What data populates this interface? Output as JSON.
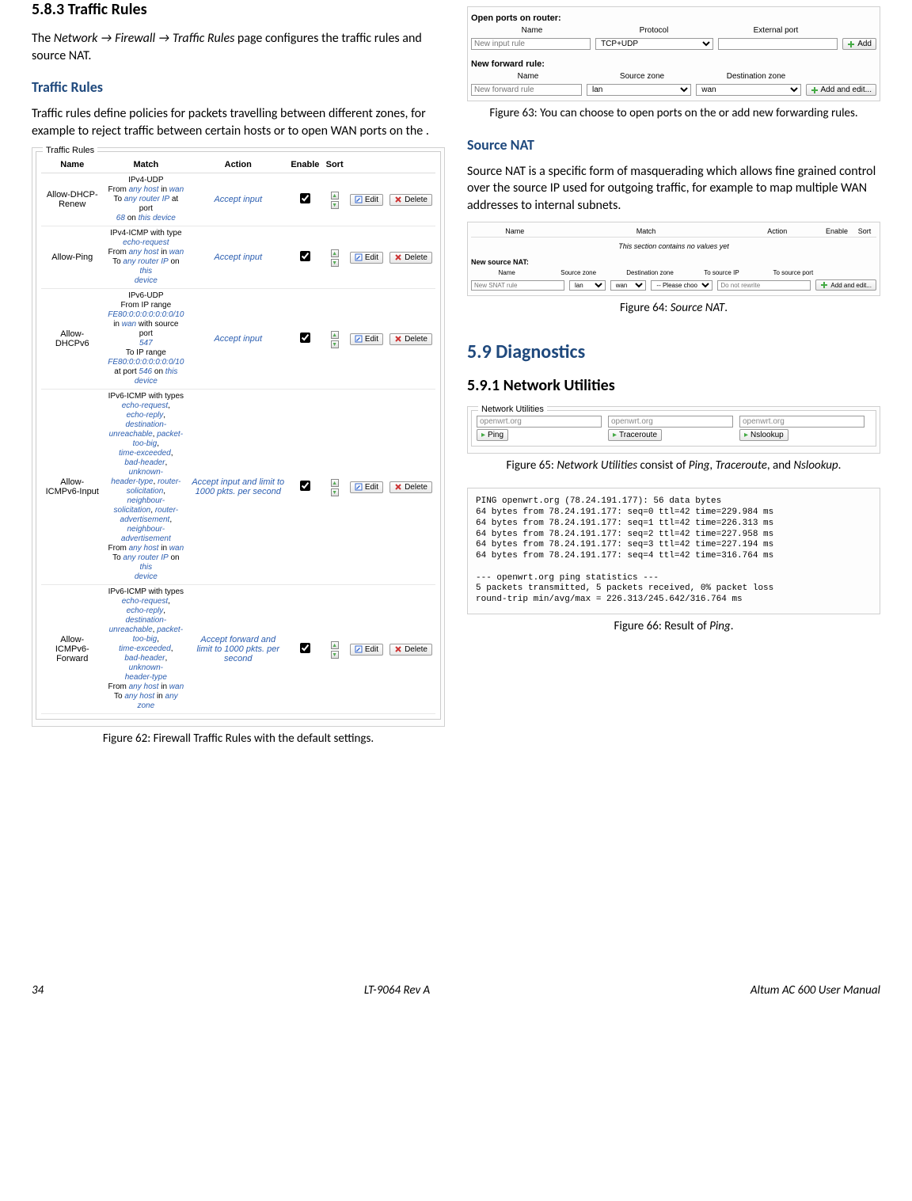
{
  "left": {
    "section_num": "5.8.3",
    "section_title": "Traffic Rules",
    "intro_pre": "The ",
    "intro_path": "Network → Firewall → Traffic Rules",
    "intro_post": " page configures the traffic rules and source NAT.",
    "h_traffic": "Traffic Rules",
    "traffic_para": "Traffic rules define policies for packets travelling between different zones, for example to reject traffic between certain hosts or to open WAN ports on the .",
    "fig62_caption": "Figure 62: Firewall Traffic Rules with the default settings.",
    "fig62": {
      "legend": "Traffic Rules",
      "headers": [
        "Name",
        "Match",
        "Action",
        "Enable",
        "Sort",
        "",
        ""
      ],
      "edit": "Edit",
      "delete": "Delete",
      "rows": [
        {
          "name": "Allow-DHCP-Renew",
          "match_lines": [
            "IPv4-UDP",
            "From <b>any host</b> in <b>wan</b>",
            "To <b>any router IP</b> at port",
            "<b>68</b> on <b>this device</b>"
          ],
          "action": "Accept input"
        },
        {
          "name": "Allow-Ping",
          "match_lines": [
            "IPv4-ICMP with type",
            "<b>echo-request</b>",
            "From <b>any host</b> in <b>wan</b>",
            "To <b>any router IP</b> on <b>this</b>",
            "<b>device</b>"
          ],
          "action": "Accept input"
        },
        {
          "name": "Allow-DHCPv6",
          "match_lines": [
            "IPv6-UDP",
            "From IP range",
            "<b>FE80:0:0:0:0:0:0:0/10</b>",
            "in <b>wan</b> with source port",
            "<b>547</b>",
            "To IP range",
            "<b>FE80:0:0:0:0:0:0:0/10</b>",
            "at port <b>546</b> on <b>this</b>",
            "<b>device</b>"
          ],
          "action": "Accept input"
        },
        {
          "name": "Allow-ICMPv6-Input",
          "match_lines": [
            "IPv6-ICMP with types",
            "<b>echo-request</b>,",
            "<b>echo-reply</b>, <b>destination-</b>",
            "<b>unreachable</b>, <b>packet-</b>",
            "<b>too-big</b>,",
            "<b>time-exceeded</b>,",
            "<b>bad-header</b>, <b>unknown-</b>",
            "<b>header-type</b>, <b>router-</b>",
            "<b>solicitation</b>, <b>neighbour-</b>",
            "<b>solicitation</b>, <b>router-</b>",
            "<b>advertisement</b>,",
            "<b>neighbour-</b>",
            "<b>advertisement</b>",
            "From <b>any host</b> in <b>wan</b>",
            "To <b>any router IP</b> on <b>this</b>",
            "<b>device</b>"
          ],
          "action": "Accept input and limit to 1000 pkts. per second"
        },
        {
          "name": "Allow-ICMPv6-Forward",
          "match_lines": [
            "IPv6-ICMP with types",
            "<b>echo-request</b>,",
            "<b>echo-reply</b>, <b>destination-</b>",
            "<b>unreachable</b>, <b>packet-</b>",
            "<b>too-big</b>,",
            "<b>time-exceeded</b>,",
            "<b>bad-header</b>, <b>unknown-</b>",
            "<b>header-type</b>",
            "From <b>any host</b> in <b>wan</b>",
            "To <b>any host</b> in <b>any zone</b>"
          ],
          "action": "Accept forward and limit to 1000 pkts. per second"
        }
      ]
    }
  },
  "right": {
    "fig63": {
      "open_ports_label": "Open ports on router:",
      "hdr_name": "Name",
      "hdr_proto": "Protocol",
      "hdr_ext": "External port",
      "name_ph": "New input rule",
      "proto_val": "TCP+UDP",
      "add_label": "Add",
      "fwd_label": "New forward rule:",
      "hdr_src": "Source zone",
      "hdr_dst": "Destination zone",
      "fwd_ph": "New forward rule",
      "src_val": "lan",
      "dst_val": "wan",
      "addedit_label": "Add and edit..."
    },
    "fig63_caption": "Figure 63: You can choose to open ports on the     or add new forwarding rules.",
    "h_snat": "Source NAT",
    "snat_para": "Source NAT is a specific form of masquerading which allows fine grained control over the source IP used for outgoing traffic, for example to map multiple WAN addresses to internal subnets.",
    "fig64": {
      "hdr_name": "Name",
      "hdr_match": "Match",
      "hdr_action": "Action",
      "hdr_enable": "Enable",
      "hdr_sort": "Sort",
      "empty": "This section contains no values yet",
      "newlabel": "New source NAT:",
      "h_name": "Name",
      "h_src": "Source zone",
      "h_dst": "Destination zone",
      "h_tosip": "To source IP",
      "h_tosport": "To source port",
      "name_ph": "New SNAT rule",
      "src_val": "lan",
      "dst_val": "wan",
      "tosip_val": "-- Please choo",
      "tosport_ph": "Do not rewrite",
      "addedit_label": "Add and edit..."
    },
    "fig64_caption_pre": "Figure 64: ",
    "fig64_caption_em": "Source NAT",
    "fig64_caption_post": ".",
    "h59": "5.9    Diagnostics",
    "h591": "5.9.1 Network Utilities",
    "fig65": {
      "legend": "Network Utilities",
      "host": "openwrt.org",
      "ping": "Ping",
      "trace": "Traceroute",
      "nslookup": "Nslookup"
    },
    "fig65_caption_pre": "Figure 65: ",
    "fig65_caption_em1": "Network Utilities",
    "fig65_caption_mid": " consist of ",
    "fig65_caption_em2": "Ping",
    "fig65_caption_mid2": ", ",
    "fig65_caption_em3": "Traceroute",
    "fig65_caption_mid3": ", and ",
    "fig65_caption_em4": "Nslookup",
    "fig65_caption_post": ".",
    "fig66_text": "PING openwrt.org (78.24.191.177): 56 data bytes\n64 bytes from 78.24.191.177: seq=0 ttl=42 time=229.984 ms\n64 bytes from 78.24.191.177: seq=1 ttl=42 time=226.313 ms\n64 bytes from 78.24.191.177: seq=2 ttl=42 time=227.958 ms\n64 bytes from 78.24.191.177: seq=3 ttl=42 time=227.194 ms\n64 bytes from 78.24.191.177: seq=4 ttl=42 time=316.764 ms\n\n--- openwrt.org ping statistics ---\n5 packets transmitted, 5 packets received, 0% packet loss\nround-trip min/avg/max = 226.313/245.642/316.764 ms",
    "fig66_caption_pre": "Figure 66: Result of ",
    "fig66_caption_em": "Ping",
    "fig66_caption_post": "."
  },
  "footer": {
    "page": "34",
    "center": "LT-9064 Rev A",
    "right": "Altum AC 600 User Manual"
  }
}
